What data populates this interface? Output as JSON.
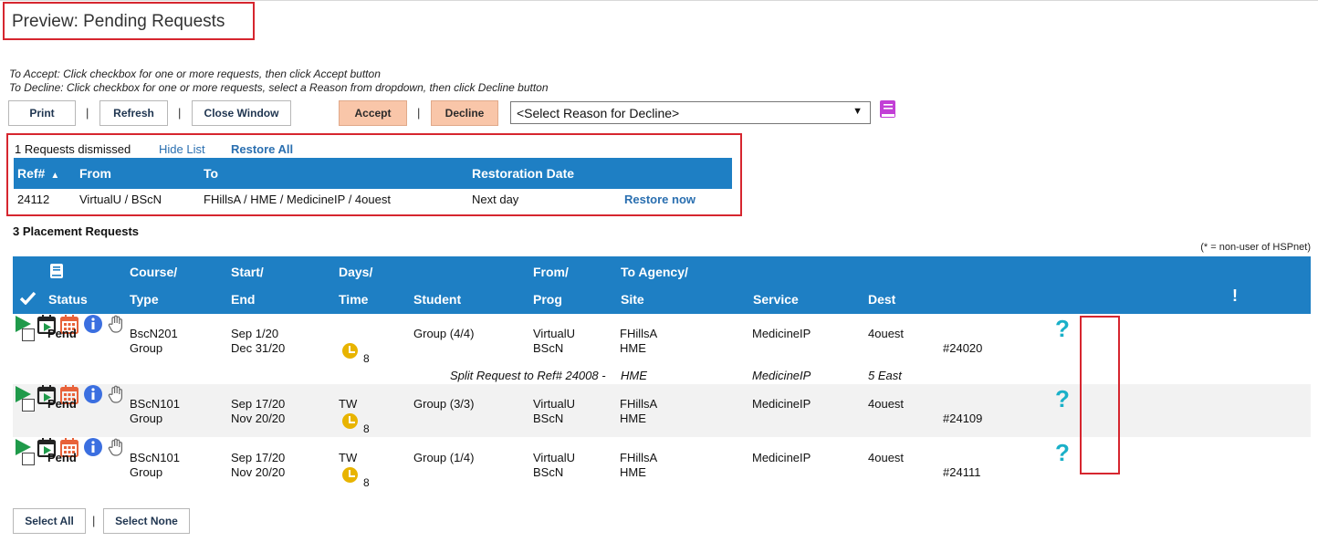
{
  "page": {
    "title": "Preview: Pending Requests"
  },
  "instructions": {
    "accept": "To Accept: Click checkbox for one or more requests, then click Accept button",
    "decline": "To Decline: Click checkbox for one or more requests, select a Reason from dropdown, then click Decline button"
  },
  "toolbar": {
    "print": "Print",
    "refresh": "Refresh",
    "close_window": "Close Window",
    "accept": "Accept",
    "decline": "Decline",
    "separator": "|",
    "reason_select": "<Select Reason for Decline>"
  },
  "dismissed": {
    "summary": "1 Requests dismissed",
    "hide_list": "Hide List",
    "restore_all": "Restore All",
    "columns": {
      "ref": "Ref#",
      "from": "From",
      "to": "To",
      "restoration_date": "Restoration Date"
    },
    "rows": [
      {
        "ref": "24112",
        "from": "VirtualU / BScN",
        "to": "FHillsA / HME / MedicineIP / 4ouest",
        "restoration_date": "Next day",
        "action": "Restore now"
      }
    ]
  },
  "requests": {
    "count_label": "3 Placement Requests",
    "legend_note": "(* = non-user of HSPnet)",
    "header": {
      "status": "Status",
      "course": "Course/",
      "type": "Type",
      "start": "Start/",
      "end": "End",
      "days": "Days/",
      "time": "Time",
      "student": "Student",
      "from": "From/",
      "prog": "Prog",
      "to_agency": "To Agency/",
      "site": "Site",
      "service": "Service",
      "dest": "Dest",
      "alert": "!"
    },
    "rows": [
      {
        "status": "Pend",
        "course": "BscN201",
        "type": "Group",
        "start": "Sep 1/20",
        "end": "Dec 31/20",
        "days": "",
        "time": "8",
        "student": "Group (4/4)",
        "from": "VirtualU",
        "prog": "BScN",
        "to": "FHillsA",
        "site": "HME",
        "service": "MedicineIP",
        "dest": "4ouest",
        "ref": "#24020"
      },
      {
        "status": "Pend",
        "course": "BScN101",
        "type": "Group",
        "start": "Sep 17/20",
        "end": "Nov 20/20",
        "days": "TW",
        "time": "8",
        "student": "Group (3/3)",
        "from": "VirtualU",
        "prog": "BScN",
        "to": "FHillsA",
        "site": "HME",
        "service": "MedicineIP",
        "dest": "4ouest",
        "ref": "#24109"
      },
      {
        "status": "Pend",
        "course": "BScN101",
        "type": "Group",
        "start": "Sep 17/20",
        "end": "Nov 20/20",
        "days": "TW",
        "time": "8",
        "student": "Group (1/4)",
        "from": "VirtualU",
        "prog": "BScN",
        "to": "FHillsA",
        "site": "HME",
        "service": "MedicineIP",
        "dest": "4ouest",
        "ref": "#24111"
      }
    ],
    "split_note": {
      "text": "Split Request to Ref# 24008 -",
      "site": "HME",
      "service": "MedicineIP",
      "dest": "5 East"
    }
  },
  "footer": {
    "select_all": "Select All",
    "select_none": "Select None",
    "separator": "|"
  },
  "colors": {
    "header_blue": "#1e7fc4",
    "highlight_red": "#d6262f",
    "peach": "#f9c6a9",
    "green": "#1f9a4a",
    "orange": "#e8623a",
    "info_blue": "#3b6fe0",
    "teal": "#1ab0c8"
  },
  "icons": [
    "check-icon",
    "book-icon",
    "play-icon",
    "calendar-play-icon",
    "calendar-icon",
    "info-icon",
    "help-icon",
    "hand-icon",
    "clock-icon",
    "sort-asc-icon"
  ]
}
